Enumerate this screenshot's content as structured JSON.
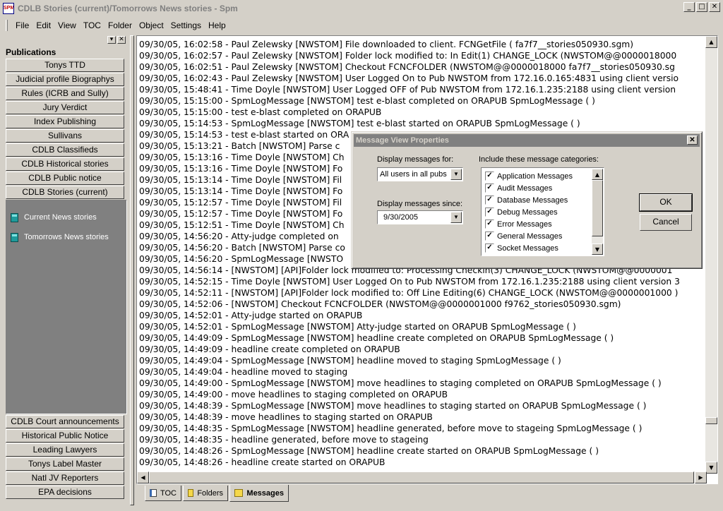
{
  "window": {
    "title": "CDLB Stories (current)/Tomorrows News stories - Spm",
    "app_icon_text": "SPM",
    "min_label": "_",
    "max_label": "□",
    "close_label": "✕"
  },
  "menu": [
    "File",
    "Edit",
    "View",
    "TOC",
    "Folder",
    "Object",
    "Settings",
    "Help"
  ],
  "sidebar": {
    "heading": "Publications",
    "pin_label": "▾",
    "close_label": "✕",
    "top_items": [
      "Tonys TTD",
      "Judicial profile Biographys",
      "Rules (ICRB and Sully)",
      "Jury Verdict",
      "Index Publishing",
      "Sullivans",
      "CDLB Classifieds",
      "CDLB Historical stories",
      "CDLB Public notice",
      "CDLB Stories (current)"
    ],
    "tree_items": [
      "Current News stories",
      "Tomorrows News stories"
    ],
    "bottom_items": [
      "CDLB Court announcements",
      "Historical Public Notice",
      "Leading Lawyers",
      "Tonys Label Master",
      "Natl JV Reporters",
      "EPA decisions"
    ]
  },
  "log": [
    "09/30/05, 16:02:58 - Paul Zelewsky [NWSTOM] File downloaded to client. FCNGetFile ( fa7f7__stories050930.sgm)",
    "09/30/05, 16:02:57 - Paul Zelewsky [NWSTOM] Folder lock modified to: In Edit(1) CHANGE_LOCK (NWSTOM@@0000018000",
    "09/30/05, 16:02:51 - Paul Zelewsky [NWSTOM] Checkout FCNCFOLDER (NWSTOM@@0000018000 fa7f7__stories050930.sg",
    "09/30/05, 16:02:43 - Paul Zelewsky [NWSTOM] User Logged On to Pub NWSTOM from 172.16.0.165:4831 using client versio",
    "09/30/05, 15:48:41 - Time Doyle [NWSTOM] User Logged OFF of Pub NWSTOM from 172.16.1.235:2188 using client version",
    "09/30/05, 15:15:00 - SpmLogMessage [NWSTOM] test e-blast completed on ORAPUB SpmLogMessage ( )",
    "09/30/05, 15:15:00 - test e-blast completed on ORAPUB",
    "09/30/05, 15:14:53 - SpmLogMessage [NWSTOM] test e-blast started on ORAPUB SpmLogMessage ( )",
    "09/30/05, 15:14:53 - test e-blast started on ORA",
    "09/30/05, 15:13:21 - Batch [NWSTOM] Parse c",
    "09/30/05, 15:13:16 - Time Doyle [NWSTOM] Ch",
    "09/30/05, 15:13:16 - Time Doyle [NWSTOM] Fo",
    "09/30/05, 15:13:14 - Time Doyle [NWSTOM] Fil",
    "09/30/05, 15:13:14 - Time Doyle [NWSTOM] Fo",
    "09/30/05, 15:12:57 - Time Doyle [NWSTOM] Fil",
    "09/30/05, 15:12:57 - Time Doyle [NWSTOM] Fo",
    "09/30/05, 15:12:51 - Time Doyle [NWSTOM] Ch",
    "09/30/05, 14:56:20 - Atty-judge completed on",
    "09/30/05, 14:56:20 - Batch [NWSTOM] Parse co",
    "09/30/05, 14:56:20 - SpmLogMessage [NWSTO",
    "09/30/05, 14:56:14 -  [NWSTOM] [API]Folder lock modified to: Processing Checkin(3) CHANGE_LOCK (NWSTOM@@0000001",
    "09/30/05, 14:52:15 - Time Doyle [NWSTOM] User Logged On to Pub NWSTOM from 172.16.1.235:2188 using client version 3",
    "09/30/05, 14:52:11 -  [NWSTOM] [API]Folder lock modified to: Off Line Editing(6) CHANGE_LOCK (NWSTOM@@0000001000 )",
    "09/30/05, 14:52:06 -  [NWSTOM] Checkout FCNCFOLDER (NWSTOM@@0000001000 f9762_stories050930.sgm)",
    "09/30/05, 14:52:01 - Atty-judge started on ORAPUB",
    "09/30/05, 14:52:01 - SpmLogMessage [NWSTOM] Atty-judge started on ORAPUB SpmLogMessage ( )",
    "09/30/05, 14:49:09 - SpmLogMessage [NWSTOM] headline create completed on ORAPUB SpmLogMessage ( )",
    "09/30/05, 14:49:09 - headline create completed on ORAPUB",
    "09/30/05, 14:49:04 - SpmLogMessage [NWSTOM] headline moved to staging SpmLogMessage ( )",
    "09/30/05, 14:49:04 - headline moved to staging",
    "09/30/05, 14:49:00 - SpmLogMessage [NWSTOM] move headlines to staging completed on ORAPUB SpmLogMessage ( )",
    "09/30/05, 14:49:00 - move headlines to staging completed on ORAPUB",
    "09/30/05, 14:48:39 - SpmLogMessage [NWSTOM] move headlines to staging started on ORAPUB SpmLogMessage ( )",
    "09/30/05, 14:48:39 - move headlines to staging started on ORAPUB",
    "09/30/05, 14:48:35 - SpmLogMessage [NWSTOM] headline generated, before move to stageing SpmLogMessage ( )",
    "09/30/05, 14:48:35 - headline generated, before move to stageing",
    "09/30/05, 14:48:26 - SpmLogMessage [NWSTOM] headline create started on ORAPUB SpmLogMessage ( )",
    "09/30/05, 14:48:26 - headline create started on ORAPUB"
  ],
  "tabs": [
    "TOC",
    "Folders",
    "Messages"
  ],
  "dialog": {
    "title": "Message View Properties",
    "close_label": "✕",
    "display_for_label": "Display messages for:",
    "display_for_value": "All users in all pubs",
    "display_since_label": "Display messages since:",
    "display_since_value": "9/30/2005",
    "categories_label": "Include these message categories:",
    "categories": [
      "Application Messages",
      "Audit Messages",
      "Database Messages",
      "Debug Messages",
      "Error Messages",
      "General Messages",
      "Socket Messages"
    ],
    "checkmark": "✓",
    "ok_label": "OK",
    "cancel_label": "Cancel"
  }
}
